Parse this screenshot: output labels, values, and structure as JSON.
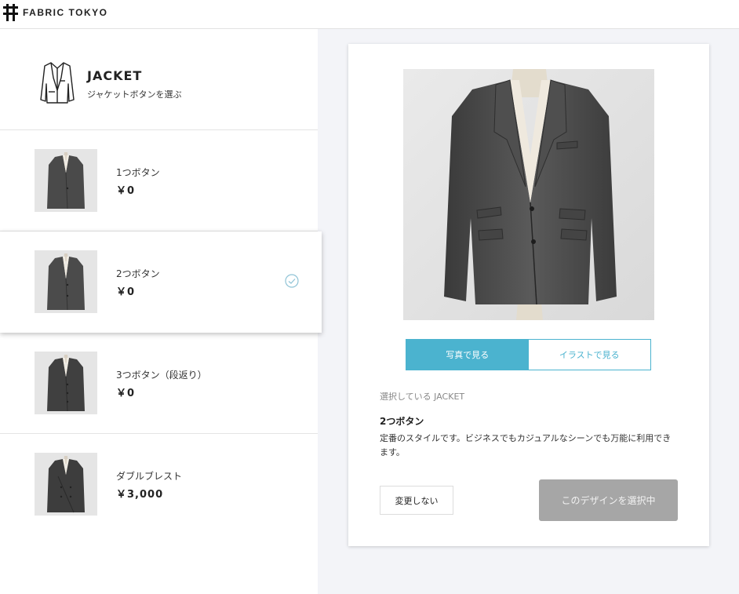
{
  "header": {
    "brand_name": "FABRIC TOKYO",
    "logo_icon": "fabric-tokyo-logo"
  },
  "category": {
    "title": "JACKET",
    "subtitle": "ジャケットボタンを選ぶ",
    "icon": "jacket-outline-icon"
  },
  "options": [
    {
      "name": "1つボタン",
      "price": "￥0",
      "selected": false
    },
    {
      "name": "2つボタン",
      "price": "￥0",
      "selected": true
    },
    {
      "name": "3つボタン（段返り）",
      "price": "￥0",
      "selected": false
    },
    {
      "name": "ダブルブレスト",
      "price": "￥3,000",
      "selected": false
    }
  ],
  "detail": {
    "view_toggle": {
      "photo_label": "写真で見る",
      "illustration_label": "イラストで見る",
      "active": "photo"
    },
    "selected_label": "選択している JACKET",
    "selected_name": "2つボタン",
    "description": "定番のスタイルです。ビジネスでもカジュアルなシーンでも万能に利用できます。",
    "keep_button": "変更しない",
    "select_button": "このデザインを選択中"
  },
  "colors": {
    "accent": "#4bb3cf",
    "disabled_button": "#a6a6a6",
    "background": "#f3f4f8"
  }
}
